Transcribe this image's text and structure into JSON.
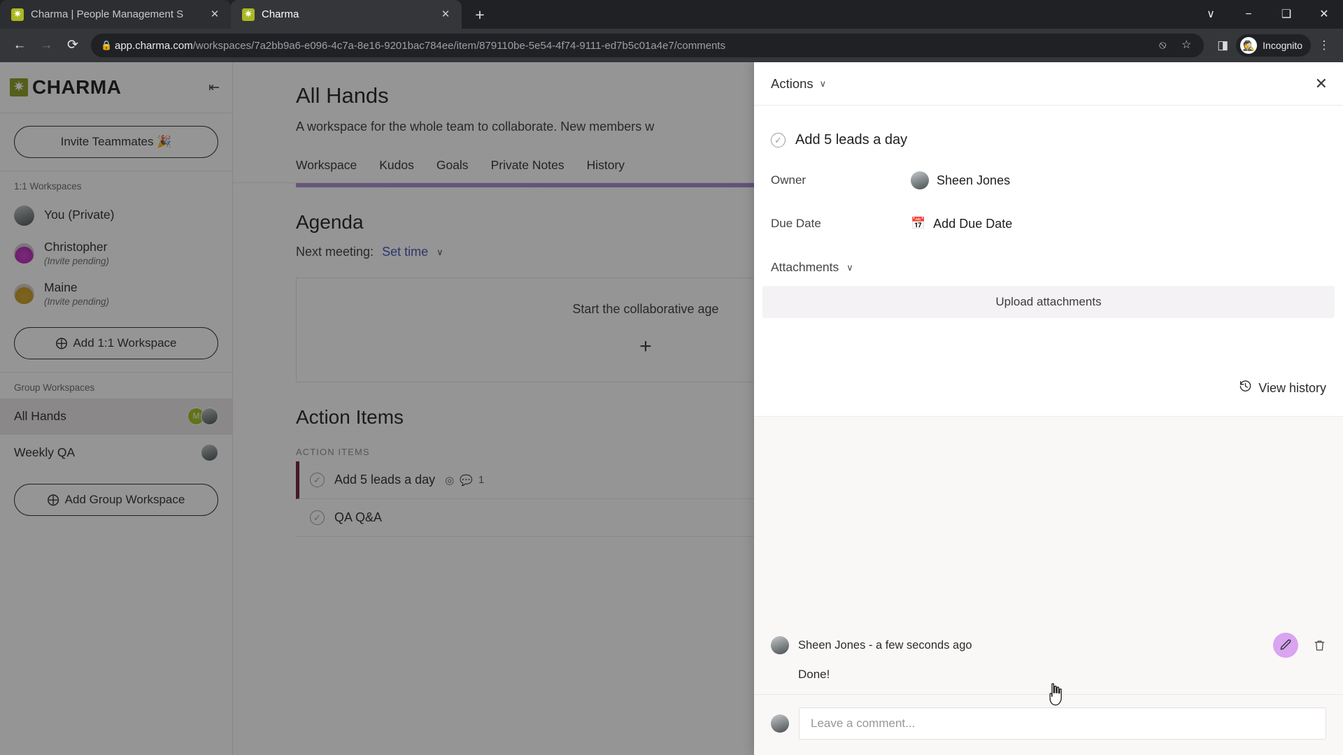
{
  "browser": {
    "tabs": [
      {
        "title": "Charma | People Management S",
        "favicon": "charma-favicon",
        "active": false
      },
      {
        "title": "Charma",
        "favicon": "charma-favicon",
        "active": true
      }
    ],
    "new_tab_label": "+",
    "window_controls": {
      "minimize": "−",
      "maximize": "❑",
      "close": "✕",
      "tab_search": "∨"
    },
    "nav": {
      "back": "←",
      "forward": "→",
      "reload": "⟳"
    },
    "omnibox": {
      "lock_icon": "🔒",
      "url_domain": "app.charma.com",
      "url_path": "/workspaces/7a2bb9a6-e096-4c7a-8e16-9201bac784ee/item/879110be-5e54-4f74-9111-ed7b5c01a4e7/comments",
      "third_party_cookie_icon": "⦸",
      "bookmark_icon": "☆"
    },
    "toolbar_right": {
      "side_panel_icon": "◨",
      "profile_label": "Incognito",
      "profile_glyph": "🕵",
      "menu_icon": "⋮"
    }
  },
  "sidebar": {
    "logo_text": "CHARMA",
    "collapse_icon": "⇤",
    "invite_button": "Invite Teammates 🎉",
    "sections": [
      {
        "label": "1:1 Workspaces",
        "items": [
          {
            "name": "You (Private)",
            "sub": "",
            "avatar": "grey"
          },
          {
            "name": "Christopher",
            "sub": "(Invite pending)",
            "avatar": "magenta"
          },
          {
            "name": "Maine",
            "sub": "(Invite pending)",
            "avatar": "gold"
          }
        ],
        "add_button": "Add 1:1 Workspace"
      },
      {
        "label": "Group Workspaces",
        "items": [
          {
            "name": "All Hands",
            "sub": "",
            "avatar": "none",
            "active": true,
            "badge": "M"
          },
          {
            "name": "Weekly QA",
            "sub": "",
            "avatar": "none",
            "active": false
          }
        ],
        "add_button": "Add Group Workspace"
      }
    ]
  },
  "main": {
    "title": "All Hands",
    "description": "A workspace for the whole team to collaborate. New members w",
    "tabs": [
      "Workspace",
      "Kudos",
      "Goals",
      "Private Notes",
      "History"
    ],
    "agenda": {
      "title": "Agenda",
      "next_meeting_label": "Next meeting:",
      "set_time_link": "Set time",
      "empty_text": "Start the collaborative age",
      "plus": "+"
    },
    "action_items": {
      "title": "Action Items",
      "list_label": "ACTION ITEMS",
      "items": [
        {
          "text": "Add 5 leads a day",
          "goal_icon": "◎",
          "comment_count": "1",
          "selected": true
        },
        {
          "text": "QA Q&A",
          "selected": false
        }
      ]
    }
  },
  "drawer": {
    "actions_label": "Actions",
    "actions_chevron": "∨",
    "close_icon": "✕",
    "item_title": "Add 5 leads a day",
    "fields": [
      {
        "label": "Owner",
        "value": "Sheen Jones",
        "icon": "avatar"
      },
      {
        "label": "Due Date",
        "value": "Add Due Date",
        "icon": "calendar-plus"
      }
    ],
    "attachments": {
      "label": "Attachments",
      "chevron": "∨",
      "upload_label": "Upload attachments"
    },
    "view_history": "View history",
    "comments": [
      {
        "author": "Sheen Jones",
        "separator": "-",
        "timestamp": "a few seconds ago",
        "meta": "Sheen Jones - a few seconds ago",
        "body": "Done!",
        "edit_icon": "pencil-icon",
        "delete_icon": "trash-icon"
      }
    ],
    "composer_placeholder": "Leave a comment..."
  },
  "colors": {
    "accent_purple": "#9f86cd",
    "brand_olive": "#8b9b22",
    "edit_highlight": "#d9a4f0",
    "selected_bar": "#6e2233",
    "badge_green": "#9dc41c"
  }
}
